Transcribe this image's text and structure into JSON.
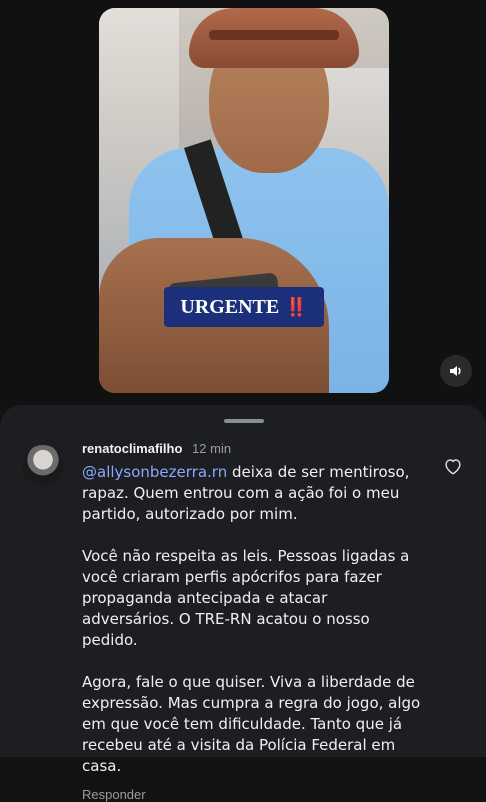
{
  "video": {
    "caption_text": "URGENTE",
    "caption_emoji": "‼️",
    "sound_icon": "speaker-icon"
  },
  "comment": {
    "username": "renatoclimafilho",
    "time": "12 min",
    "mention": "@allysonbezerra.rn",
    "paragraph1_rest": " deixa de ser mentiroso, rapaz. Quem entrou com a ação foi o meu partido, autorizado por mim.",
    "paragraph2": "Você não respeita as leis. Pessoas ligadas a você criaram perfis apócrifos para fazer propaganda antecipada e atacar adversários. O TRE-RN acatou o nosso pedido.",
    "paragraph3": "Agora, fale o que quiser. Viva a liberdade de expressão. Mas cumpra a regra do jogo, algo em que você tem dificuldade. Tanto que já recebeu até a visita da Polícia Federal em casa.",
    "reply_label": "Responder",
    "like_icon": "heart-icon"
  }
}
